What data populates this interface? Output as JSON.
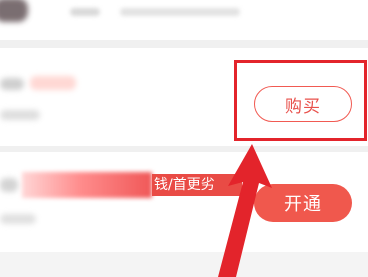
{
  "buy_item": {
    "button_label": "购买"
  },
  "membership_item": {
    "promo_tag": "钱/首更劣",
    "button_label": "开通"
  },
  "colors": {
    "accent": "#f0584d",
    "annotation": "#e3242b"
  },
  "icons": {
    "annotation_arrow": "arrow-up-icon"
  }
}
